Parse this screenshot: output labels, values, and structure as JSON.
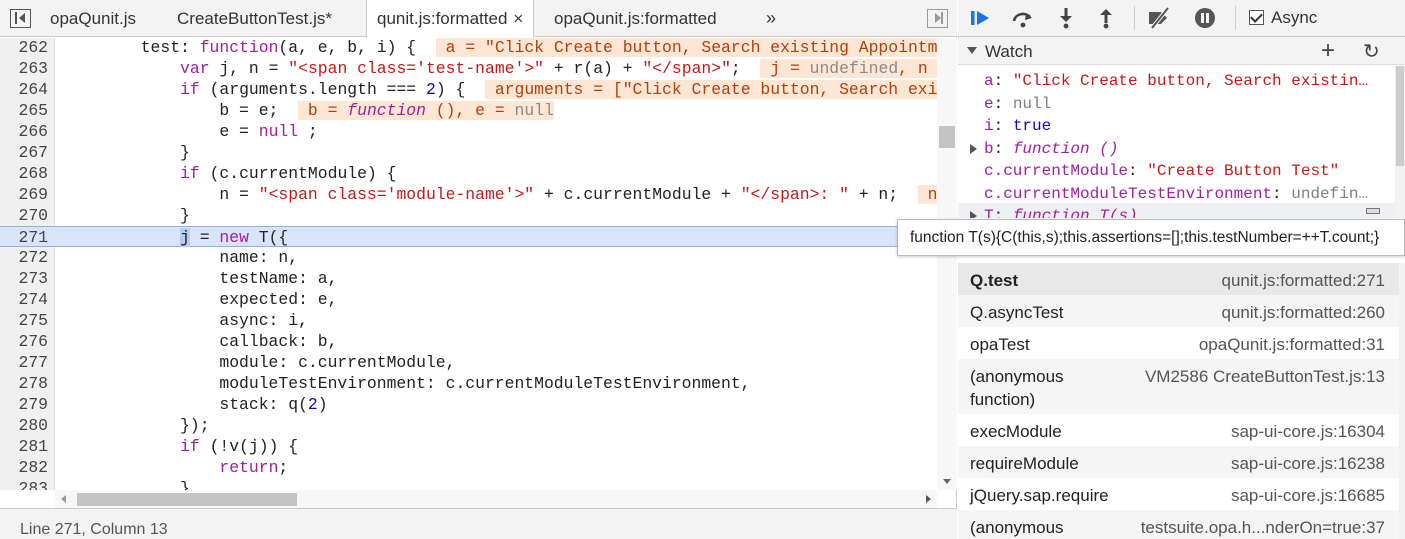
{
  "tabs": [
    {
      "label": "opaQunit.js",
      "active": false,
      "closable": false
    },
    {
      "label": "CreateButtonTest.js*",
      "active": false,
      "closable": false
    },
    {
      "label": "qunit.js:formatted",
      "active": true,
      "closable": true
    },
    {
      "label": "opaQunit.js:formatted",
      "active": false,
      "closable": false
    }
  ],
  "tab_more": "»",
  "tab_close": "×",
  "status": "Line 271, Column 13",
  "debugger": {
    "async_label": "Async",
    "async_checked": true,
    "watch_title": "Watch",
    "watch_add": "+",
    "watch_refresh": "↻"
  },
  "watch": [
    {
      "key": "a",
      "value": "\"Click Create button, Search existin…",
      "type": "string",
      "expandable": false
    },
    {
      "key": "e",
      "value": "null",
      "type": "null",
      "expandable": false
    },
    {
      "key": "i",
      "value": "true",
      "type": "bool",
      "expandable": false
    },
    {
      "key": "b",
      "value": "function ()",
      "type": "fn",
      "expandable": true
    },
    {
      "key": "c.currentModule",
      "value": "\"Create Button Test\"",
      "type": "string",
      "expandable": false
    },
    {
      "key": "c.currentModuleTestEnvironment",
      "value": "undefin…",
      "type": "undef",
      "expandable": false
    },
    {
      "key": "T",
      "value": "function T(s)",
      "type": "fn",
      "expandable": true
    }
  ],
  "tooltip": "function T(s){C(this,s);this.assertions=[];this.testNumber=++T.count;}",
  "callstack": [
    {
      "fn": "Q.test",
      "loc": "qunit.js:formatted:271",
      "selected": true
    },
    {
      "fn": "Q.asyncTest",
      "loc": "qunit.js:formatted:260",
      "selected": false
    },
    {
      "fn": "opaTest",
      "loc": "opaQunit.js:formatted:31",
      "selected": false
    },
    {
      "fn": "(anonymous\nfunction)",
      "loc": "VM2586 CreateButtonTest.js:13",
      "selected": false
    },
    {
      "fn": "execModule",
      "loc": "sap-ui-core.js:16304",
      "selected": false
    },
    {
      "fn": "requireModule",
      "loc": "sap-ui-core.js:16238",
      "selected": false
    },
    {
      "fn": "jQuery.sap.require",
      "loc": "sap-ui-core.js:16685",
      "selected": false
    },
    {
      "fn": "(anonymous",
      "loc": "testsuite.opa.h...nderOn=true:37",
      "selected": false
    }
  ],
  "code_lines": [
    {
      "n": "262",
      "html": "        test: <span class='kw'>function</span>(a, e, b, i) {  <span class='inl'> a = \"Click Create button, Search existing Appointm</span>"
    },
    {
      "n": "263",
      "html": "            <span class='kw'>var</span> j, n = <span class='str'>\"&lt;span class='test-name'&gt;\"</span> + r(a) + <span class='str'>\"&lt;/span&gt;\"</span>;  <span class='inl'> j = <span class='muted'>undefined</span>, n </span>"
    },
    {
      "n": "264",
      "html": "            <span class='kw'>if</span> (arguments.length === <span class='num'>2</span>) {  <span class='inl'> arguments = [\"Click Create button, Search exi</span>"
    },
    {
      "n": "265",
      "html": "                b = e;  <span class='inl'> b = <span class='fn'>function</span> (), e = <span class='muted'>null</span></span>"
    },
    {
      "n": "266",
      "html": "                e = <span class='kw'>null</span> ;"
    },
    {
      "n": "267",
      "html": "            }"
    },
    {
      "n": "268",
      "html": "            <span class='kw'>if</span> (c.currentModule) {"
    },
    {
      "n": "269",
      "html": "                n = <span class='str'>\"&lt;span class='module-name'&gt;\"</span> + c.currentModule + <span class='str'>\"&lt;/span&gt;: \"</span> + n;  <span class='inl'> n</span>"
    },
    {
      "n": "270",
      "html": "            }"
    },
    {
      "n": "271",
      "html": "            <span class='sel'>j</span> = <span class='kw'>new</span> T({",
      "exec": true
    },
    {
      "n": "272",
      "html": "                name: n,"
    },
    {
      "n": "273",
      "html": "                testName: a,"
    },
    {
      "n": "274",
      "html": "                expected: e,"
    },
    {
      "n": "275",
      "html": "                async: i,"
    },
    {
      "n": "276",
      "html": "                callback: b,"
    },
    {
      "n": "277",
      "html": "                module: c.currentModule,"
    },
    {
      "n": "278",
      "html": "                moduleTestEnvironment: c.currentModuleTestEnvironment,"
    },
    {
      "n": "279",
      "html": "                stack: q(<span class='num'>2</span>)"
    },
    {
      "n": "280",
      "html": "            });"
    },
    {
      "n": "281",
      "html": "            <span class='kw'>if</span> (!v(j)) {"
    },
    {
      "n": "282",
      "html": "                <span class='kw'>return</span>;"
    },
    {
      "n": "283",
      "html": "            }"
    }
  ],
  "colors": {
    "keyword": "#a020a0",
    "string": "#c41a16",
    "exec_line": "#d9e3f9",
    "inline_value_bg": "#fde6d4",
    "resume_icon": "#1a73e8"
  }
}
